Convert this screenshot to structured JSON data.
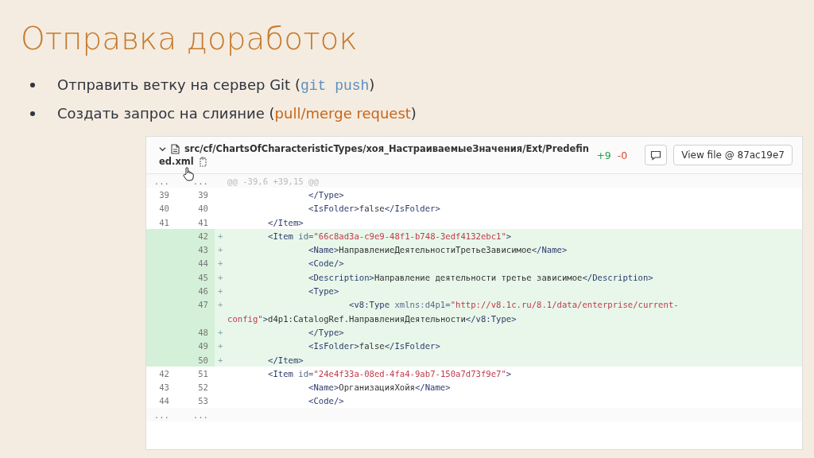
{
  "title": "Отправка доработок",
  "bullets": [
    [
      {
        "kind": "text",
        "text": "Отправить ветку на сервер Git ("
      },
      {
        "kind": "code",
        "text": "git push"
      },
      {
        "kind": "text",
        "text": ")"
      }
    ],
    [
      {
        "kind": "text",
        "text": "Создать запрос на слияние ("
      },
      {
        "kind": "accent",
        "text": "pull/merge request"
      },
      {
        "kind": "text",
        "text": ")"
      }
    ]
  ],
  "diff": {
    "file_path_lines": [
      "src/cf/ChartsOfCharacteristicTypes/хоя_НастраиваемыеЗначения/Ext/Predefin",
      "ed.xml"
    ],
    "expanded": true,
    "additions": "+9",
    "deletions": "-0",
    "view_file": "View file @ 87ac19e7",
    "rows": [
      {
        "kind": "expander",
        "old": "...",
        "new": "...",
        "tokens": [
          {
            "kind": "meta",
            "text": "@@ -39,6 +39,15 @@"
          }
        ]
      },
      {
        "kind": "context",
        "old": "39",
        "new": "39",
        "tokens": [
          {
            "kind": "tab"
          },
          {
            "kind": "tab"
          },
          {
            "kind": "tag",
            "text": "</Type>"
          }
        ]
      },
      {
        "kind": "context",
        "old": "40",
        "new": "40",
        "tokens": [
          {
            "kind": "tab"
          },
          {
            "kind": "tab"
          },
          {
            "kind": "tag",
            "text": "<IsFolder>"
          },
          {
            "kind": "plain",
            "text": "false"
          },
          {
            "kind": "tag",
            "text": "</IsFolder>"
          }
        ]
      },
      {
        "kind": "context",
        "old": "41",
        "new": "41",
        "tokens": [
          {
            "kind": "tab"
          },
          {
            "kind": "tag",
            "text": "</Item>"
          }
        ]
      },
      {
        "kind": "added",
        "new": "42",
        "sign": "+",
        "tokens": [
          {
            "kind": "tab"
          },
          {
            "kind": "tag",
            "text": "<Item "
          },
          {
            "kind": "attr",
            "text": "id="
          },
          {
            "kind": "string",
            "text": "\"66c8ad3a-c9e9-48f1-b748-3edf4132ebc1\""
          },
          {
            "kind": "tag",
            "text": ">"
          }
        ]
      },
      {
        "kind": "added",
        "new": "43",
        "sign": "+",
        "tokens": [
          {
            "kind": "tab"
          },
          {
            "kind": "tab"
          },
          {
            "kind": "tag",
            "text": "<Name>"
          },
          {
            "kind": "plain",
            "text": "НаправлениеДеятельностиТретьеЗависимое"
          },
          {
            "kind": "tag",
            "text": "</Name>"
          }
        ]
      },
      {
        "kind": "added",
        "new": "44",
        "sign": "+",
        "tokens": [
          {
            "kind": "tab"
          },
          {
            "kind": "tab"
          },
          {
            "kind": "tag",
            "text": "<Code/>"
          }
        ]
      },
      {
        "kind": "added",
        "new": "45",
        "sign": "+",
        "tokens": [
          {
            "kind": "tab"
          },
          {
            "kind": "tab"
          },
          {
            "kind": "tag",
            "text": "<Description>"
          },
          {
            "kind": "plain",
            "text": "Направление деятельности третье зависимое"
          },
          {
            "kind": "tag",
            "text": "</Description>"
          }
        ]
      },
      {
        "kind": "added",
        "new": "46",
        "sign": "+",
        "tokens": [
          {
            "kind": "tab"
          },
          {
            "kind": "tab"
          },
          {
            "kind": "tag",
            "text": "<Type>"
          }
        ]
      },
      {
        "kind": "added",
        "new": "47",
        "sign": "+",
        "tokens": [
          {
            "kind": "tab"
          },
          {
            "kind": "tab"
          },
          {
            "kind": "tab"
          },
          {
            "kind": "tag",
            "text": "<v8:Type "
          },
          {
            "kind": "attr",
            "text": "xmlns:d4p1="
          },
          {
            "kind": "string",
            "text": "\"http://v8.1c.ru/8.1/data/enterprise/current-"
          }
        ]
      },
      {
        "kind": "continuation",
        "tokens": [
          {
            "kind": "string",
            "text": "config\""
          },
          {
            "kind": "tag",
            "text": ">"
          },
          {
            "kind": "plain",
            "text": "d4p1:CatalogRef.НаправленияДеятельности"
          },
          {
            "kind": "tag",
            "text": "</v8:Type>"
          }
        ]
      },
      {
        "kind": "added",
        "new": "48",
        "sign": "+",
        "tokens": [
          {
            "kind": "tab"
          },
          {
            "kind": "tab"
          },
          {
            "kind": "tag",
            "text": "</Type>"
          }
        ]
      },
      {
        "kind": "added",
        "new": "49",
        "sign": "+",
        "tokens": [
          {
            "kind": "tab"
          },
          {
            "kind": "tab"
          },
          {
            "kind": "tag",
            "text": "<IsFolder>"
          },
          {
            "kind": "plain",
            "text": "false"
          },
          {
            "kind": "tag",
            "text": "</IsFolder>"
          }
        ]
      },
      {
        "kind": "added",
        "new": "50",
        "sign": "+",
        "tokens": [
          {
            "kind": "tab"
          },
          {
            "kind": "tag",
            "text": "</Item>"
          }
        ]
      },
      {
        "kind": "context",
        "old": "42",
        "new": "51",
        "tokens": [
          {
            "kind": "tab"
          },
          {
            "kind": "tag",
            "text": "<Item "
          },
          {
            "kind": "attr",
            "text": "id="
          },
          {
            "kind": "string",
            "text": "\"24e4f33a-08ed-4fa4-9ab7-150a7d73f9e7\""
          },
          {
            "kind": "tag",
            "text": ">"
          }
        ]
      },
      {
        "kind": "context",
        "old": "43",
        "new": "52",
        "tokens": [
          {
            "kind": "tab"
          },
          {
            "kind": "tab"
          },
          {
            "kind": "tag",
            "text": "<Name>"
          },
          {
            "kind": "plain",
            "text": "ОрганизацияХойя"
          },
          {
            "kind": "tag",
            "text": "</Name>"
          }
        ]
      },
      {
        "kind": "context",
        "old": "44",
        "new": "53",
        "tokens": [
          {
            "kind": "tab"
          },
          {
            "kind": "tab"
          },
          {
            "kind": "tag",
            "text": "<Code/>"
          }
        ]
      },
      {
        "kind": "expander",
        "old": "...",
        "new": "..."
      }
    ]
  }
}
